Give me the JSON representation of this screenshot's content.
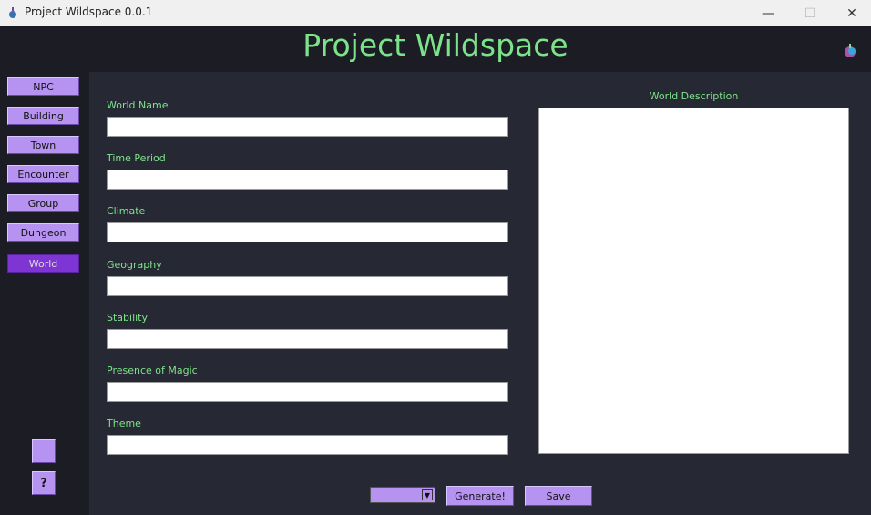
{
  "window": {
    "title": "Project Wildspace 0.0.1",
    "minimize": "—",
    "maximize": "☐",
    "close": "✕"
  },
  "header": {
    "title": "Project Wildspace"
  },
  "sidebar": {
    "items": [
      {
        "label": "NPC"
      },
      {
        "label": "Building"
      },
      {
        "label": "Town"
      },
      {
        "label": "Encounter"
      },
      {
        "label": "Group"
      },
      {
        "label": "Dungeon"
      },
      {
        "label": "World",
        "active": true
      }
    ],
    "help_label": "?"
  },
  "form": {
    "fields": [
      {
        "label": "World Name",
        "value": ""
      },
      {
        "label": "Time Period",
        "value": ""
      },
      {
        "label": "Climate",
        "value": ""
      },
      {
        "label": "Geography",
        "value": ""
      },
      {
        "label": "Stability",
        "value": ""
      },
      {
        "label": "Presence of Magic",
        "value": ""
      },
      {
        "label": "Theme",
        "value": ""
      }
    ],
    "description_label": "World Description",
    "description_value": ""
  },
  "actions": {
    "dropdown_value": "",
    "generate_label": "Generate!",
    "save_label": "Save"
  },
  "colors": {
    "accent": "#b693f0",
    "active": "#7e35d3",
    "title_green": "#7de38a",
    "background": "#262833"
  }
}
